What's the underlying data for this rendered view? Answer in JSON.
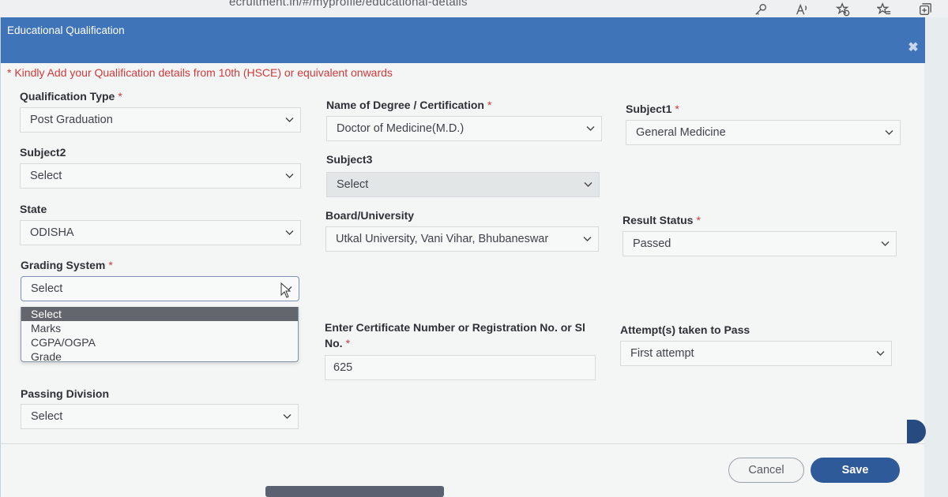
{
  "browser": {
    "url_fragment": "ecruitment.in/#/myprofile/educational-details"
  },
  "modal": {
    "title": "Educational Qualification",
    "close_glyph": "✖",
    "notice": "* Kindly Add your Qualification details from 10th (HSCE) or equivalent onwards"
  },
  "fields": {
    "qualification_type": {
      "label": "Qualification Type",
      "required": "*",
      "value": "Post Graduation"
    },
    "degree_name": {
      "label": "Name of Degree / Certification",
      "required": "*",
      "value": "Doctor of Medicine(M.D.)"
    },
    "subject1": {
      "label": "Subject1",
      "required": "*",
      "value": "General Medicine"
    },
    "subject2": {
      "label": "Subject2",
      "value": "Select"
    },
    "subject3": {
      "label": "Subject3",
      "value": "Select"
    },
    "state": {
      "label": "State",
      "value": "ODISHA"
    },
    "board_university": {
      "label": "Board/University",
      "value": "Utkal University, Vani Vihar, Bhubaneswar"
    },
    "result_status": {
      "label": "Result Status",
      "required": "*",
      "value": "Passed"
    },
    "grading_system": {
      "label": "Grading System",
      "required": "*",
      "value": "Select",
      "options": [
        "Select",
        "Marks",
        "CGPA/OGPA",
        "Grade"
      ]
    },
    "certificate_number": {
      "label_line1": "Enter Certificate Number or Registration No. or Sl",
      "label_line2": "No.",
      "required": "*",
      "value": "625"
    },
    "attempts": {
      "label": "Attempt(s) taken to Pass",
      "value": "First attempt"
    },
    "passing_division": {
      "label": "Passing Division",
      "value": "Select"
    }
  },
  "footer": {
    "cancel_label": "Cancel",
    "save_label": "Save"
  },
  "colors": {
    "header": "#3f74b8",
    "save_button": "#2f5a99",
    "required_mark": "#d03a3a"
  }
}
